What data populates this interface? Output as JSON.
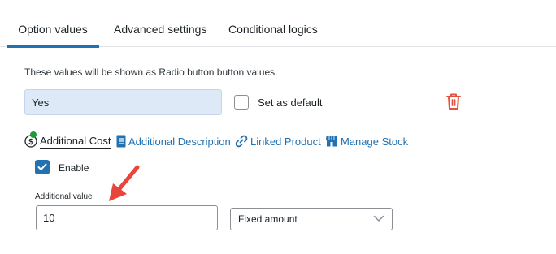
{
  "tabs": [
    {
      "label": "Option values"
    },
    {
      "label": "Advanced settings"
    },
    {
      "label": "Conditional logics"
    }
  ],
  "description": "These values will be shown as Radio button button values.",
  "option_value": "Yes",
  "set_default_label": "Set as default",
  "subtabs": [
    {
      "label": "Additional Cost",
      "icon": "dollar-icon"
    },
    {
      "label": "Additional Description",
      "icon": "document-icon"
    },
    {
      "label": "Linked Product",
      "icon": "link-icon"
    },
    {
      "label": "Manage Stock",
      "icon": "store-icon"
    }
  ],
  "enable_label": "Enable",
  "enable_checked": true,
  "additional_value_label": "Additional value",
  "additional_value": "10",
  "type_select": "Fixed amount",
  "colors": {
    "accent": "#2271b1",
    "delete": "#e15340",
    "annotation_arrow": "#e8453c",
    "status_dot": "#1a9b3c"
  }
}
